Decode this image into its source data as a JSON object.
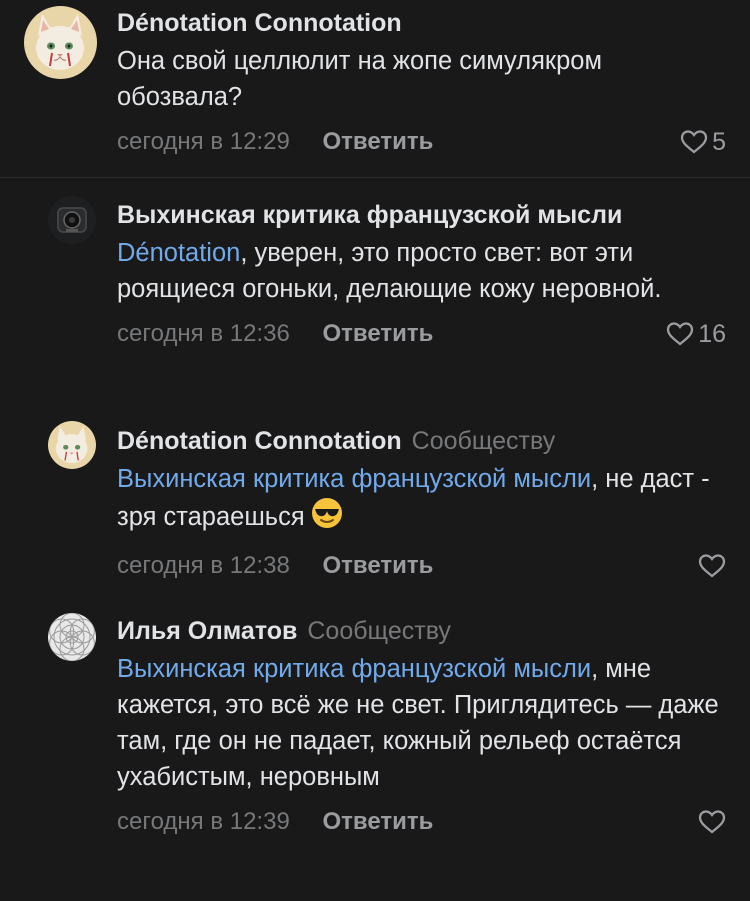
{
  "comments": [
    {
      "author": "Dénotation Connotation",
      "tag": "",
      "mention": "",
      "text": "Она свой целлюлит на жопе симулякром обозвала?",
      "time": "сегодня в 12:29",
      "reply_label": "Ответить",
      "likes": "5"
    },
    {
      "author": "Выхинская критика французской мысли",
      "tag": "",
      "mention": "Dénotation",
      "text": ", уверен, это просто свет: вот эти роящиеся огоньки, делающие кожу неровной.",
      "time": "сегодня в 12:36",
      "reply_label": "Ответить",
      "likes": "16"
    },
    {
      "author": "Dénotation Connotation",
      "tag": "Сообществу",
      "mention": "Выхинская критика французской мысли",
      "text": ", не даст - зря стараешься",
      "emoji": "smiling-face-with-sunglasses",
      "time": "сегодня в 12:38",
      "reply_label": "Ответить",
      "likes": ""
    },
    {
      "author": "Илья Олматов",
      "tag": "Сообществу",
      "mention": "Выхинская критика французской мысли",
      "text": ", мне кажется, это всё же не свет. Приглядитесь — даже там, где он не падает, кожный рельеф остаётся ухабистым, неровным",
      "time": "сегодня в 12:39",
      "reply_label": "Ответить",
      "likes": ""
    }
  ],
  "colors": {
    "background": "#19191a",
    "text": "#e1e3e6",
    "secondary": "#76787a",
    "link": "#71aaeb"
  }
}
